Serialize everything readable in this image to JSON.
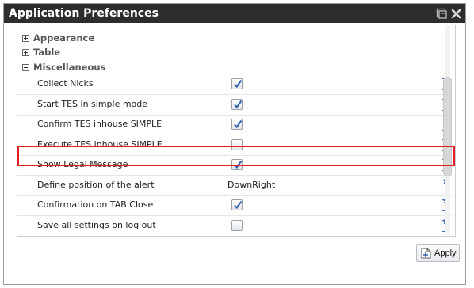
{
  "window": {
    "title": "Application Preferences"
  },
  "sections": [
    {
      "label": "Appearance",
      "expanded": false
    },
    {
      "label": "Table",
      "expanded": false
    },
    {
      "label": "Miscellaneous",
      "expanded": true
    }
  ],
  "settings": [
    {
      "label": "Collect Nicks",
      "checked": true
    },
    {
      "label": "Start TES in simple mode",
      "checked": true
    },
    {
      "label": "Confirm TES inhouse SIMPLE",
      "checked": true
    },
    {
      "label": "Execute TES inhouse SIMPLE",
      "checked": false
    },
    {
      "label": "Show Legal Message",
      "checked": true,
      "highlighted": true
    },
    {
      "label": "Define position of the alert",
      "value": "DownRight"
    },
    {
      "label": "Confirmation on TAB Close",
      "checked": true
    },
    {
      "label": "Save all settings on log out",
      "checked": false
    }
  ],
  "footer": {
    "apply_label": "Apply"
  },
  "colors": {
    "titlebar": "#2d2d2d",
    "highlight": "#e02020",
    "check": "#2f5fae"
  }
}
